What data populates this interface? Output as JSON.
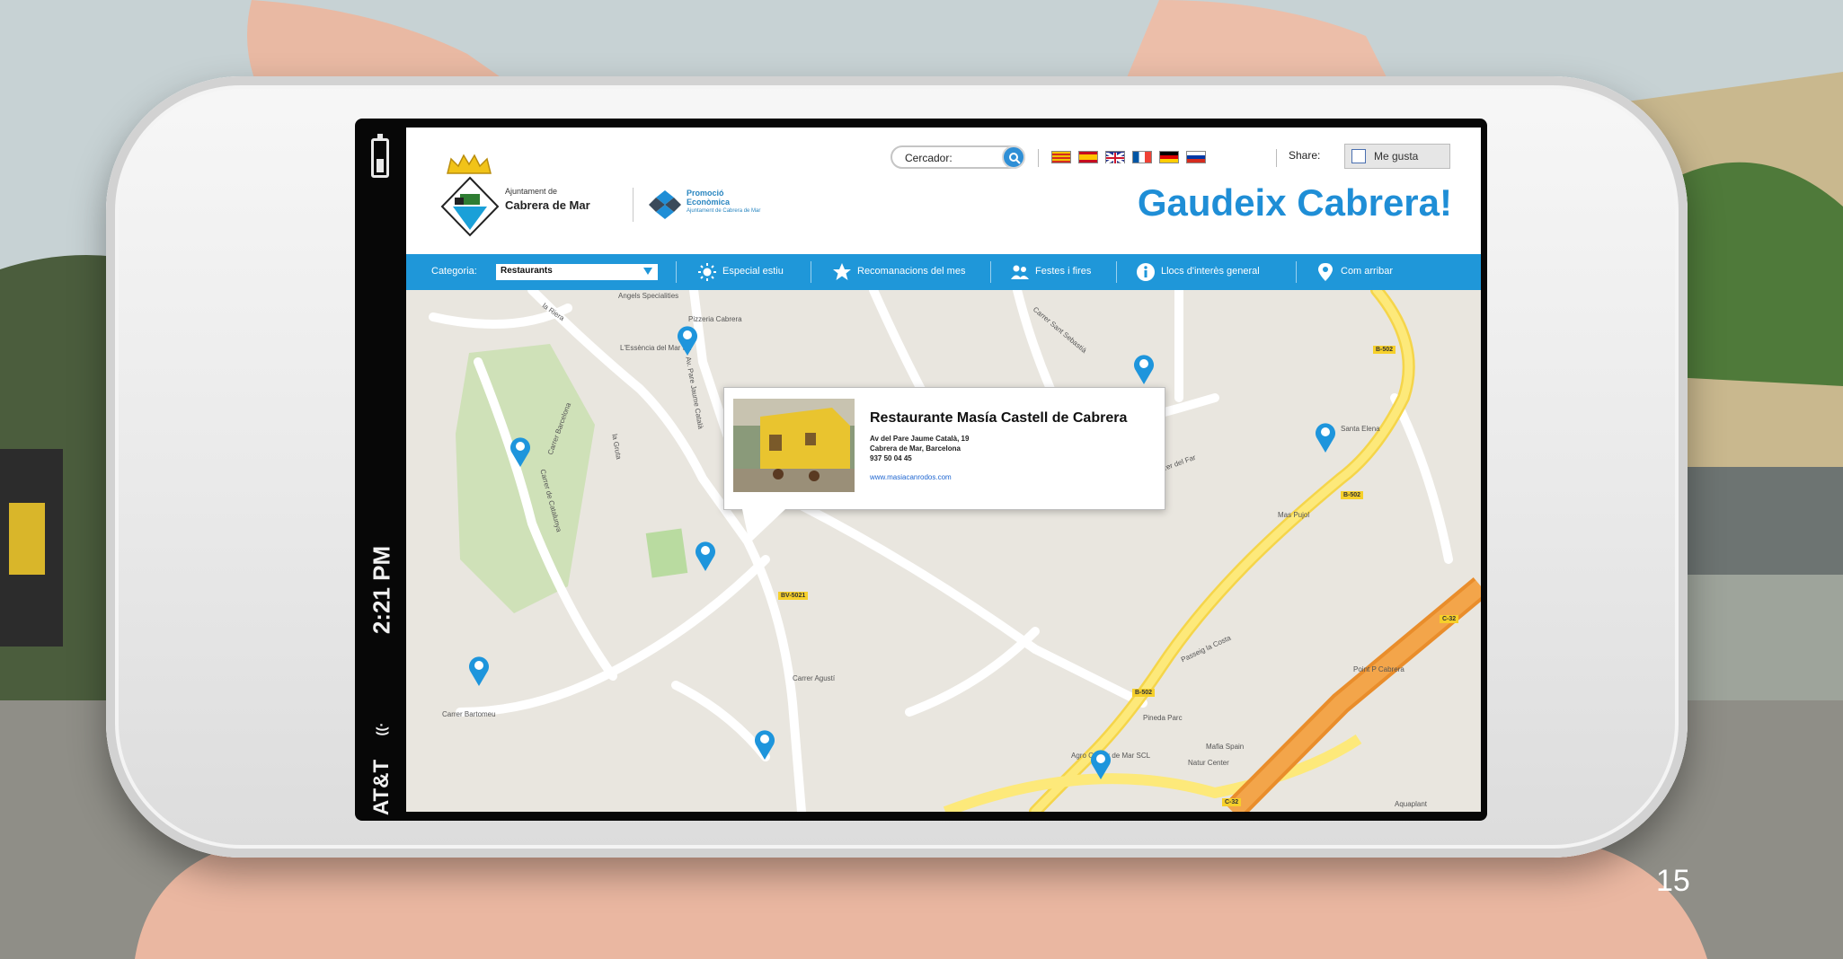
{
  "status_bar": {
    "carrier": "AT&T",
    "time": "2:21 PM"
  },
  "header": {
    "municipality_small": "Ajuntament de",
    "municipality_name": "Cabrera de Mar",
    "promo_title_1": "Promoció",
    "promo_title_2": "Econòmica",
    "promo_sub": "Ajuntament de Cabrera de Mar",
    "search_label": "Cercador:",
    "share_label": "Share:",
    "like_label": "Me gusta",
    "slogan": "Gaudeix Cabrera!",
    "flags": [
      "catalan-flag-icon",
      "spanish-flag-icon",
      "uk-flag-icon",
      "french-flag-icon",
      "german-flag-icon",
      "russian-flag-icon"
    ]
  },
  "nav": {
    "category_label": "Categoria:",
    "category_value": "Restaurants",
    "items": [
      {
        "label": "Especial estiu",
        "icon": "sun-icon"
      },
      {
        "label": "Recomanacions del mes",
        "icon": "star-icon"
      },
      {
        "label": "Festes i fires",
        "icon": "people-icon"
      },
      {
        "label": "Llocs d'interès general",
        "icon": "info-icon"
      },
      {
        "label": "Com arribar",
        "icon": "location-pin-icon"
      }
    ]
  },
  "popup": {
    "name": "Restaurante Masía Castell de Cabrera",
    "address_line_1": "Av del Pare Jaume Català, 19",
    "address_line_2": "Cabrera de Mar, Barcelona",
    "phone": "937 50 04 45",
    "website": "www.masiacanrodos.com"
  },
  "map": {
    "labels": [
      "Angels Specialities",
      "la Riera",
      "Pizzeria Cabrera",
      "L'Essència del Mar SL",
      "Av. Pare Jaume Català",
      "Carrer Barcelona",
      "Carrer de Catalunya",
      "la Gruta",
      "Carrer Sant Sebastià",
      "Santa Elena",
      "Carrer del Far",
      "Mas Pujol",
      "Passeig la Costa",
      "Carrer Agustí",
      "Carrer Bartomeu",
      "Point P Cabrera",
      "Pineda Parc",
      "Mafia Spain",
      "Natur Center",
      "Aquaplant",
      "Agro Center de Mar SCL"
    ],
    "road_tags": [
      "B-502",
      "B-502",
      "BV-5021",
      "B-502",
      "C-32",
      "C-32"
    ]
  },
  "page_number": "15",
  "colors": {
    "brand_blue": "#1f97d9",
    "slogan_blue": "#1f8ed6",
    "pin_blue": "#1e95dc",
    "road_yellow": "#fde97a",
    "highway_orange": "#f29a3c"
  }
}
